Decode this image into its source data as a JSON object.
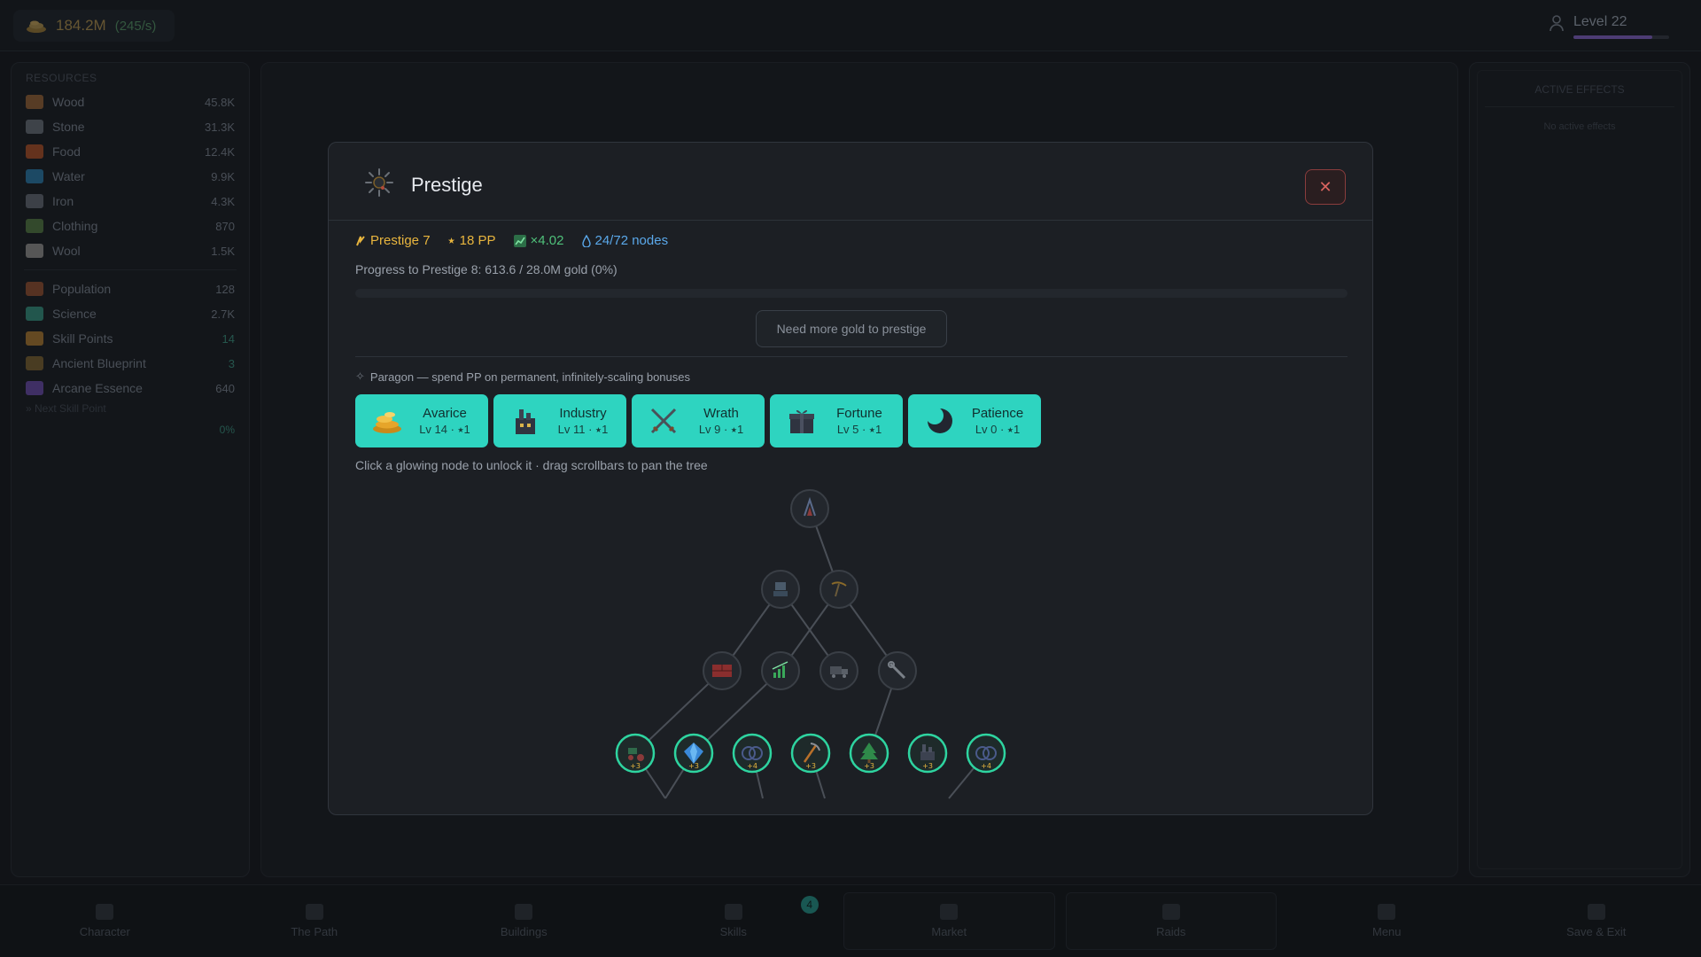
{
  "topbar": {
    "gold_value": "184.2M",
    "gold_rate": "(245/s)",
    "level_label": "Level 22",
    "level_progress": 0.82
  },
  "sidebar": {
    "title": "RESOURCES",
    "resources": [
      {
        "name": "Wood",
        "value": "45.8K",
        "icon": "wood-icon",
        "color": "#6b4a2e"
      },
      {
        "name": "Stone",
        "value": "31.3K",
        "icon": "stone-icon",
        "color": "#4c525a"
      },
      {
        "name": "Food",
        "value": "12.4K",
        "icon": "food-icon",
        "color": "#7a3e24"
      },
      {
        "name": "Water",
        "value": "9.9K",
        "icon": "water-icon",
        "color": "#235a7a"
      },
      {
        "name": "Iron",
        "value": "4.3K",
        "icon": "iron-icon",
        "color": "#4a4f57"
      },
      {
        "name": "Clothing",
        "value": "870",
        "icon": "clothing-icon",
        "color": "#3f5a36"
      },
      {
        "name": "Wool",
        "value": "1.5K",
        "icon": "wool-icon",
        "color": "#6a6a6a"
      }
    ],
    "stats": [
      {
        "name": "Population",
        "value": "128",
        "icon": "population-icon",
        "color": "#6a3e2a",
        "teal": false
      },
      {
        "name": "Science",
        "value": "2.7K",
        "icon": "science-icon",
        "color": "#2a6a5e",
        "teal": false
      },
      {
        "name": "Skill Points",
        "value": "14",
        "icon": "skill-points-icon",
        "color": "#7a5a2a",
        "teal": true
      },
      {
        "name": "Ancient Blueprint",
        "value": "3",
        "icon": "blueprint-icon",
        "color": "#5a4a2a",
        "teal": true
      },
      {
        "name": "Arcane Essence",
        "value": "640",
        "icon": "arcane-icon",
        "color": "#4e3a7a",
        "teal": false
      }
    ],
    "next_skill_point": "» Next Skill Point",
    "next_skill_pct": "0%"
  },
  "active_effects": {
    "title": "ACTIVE EFFECTS",
    "empty": "No active effects"
  },
  "modal": {
    "title": "Prestige",
    "close_label": "✕",
    "prestige_level": "Prestige 7",
    "pp": "18 PP",
    "multiplier": "×4.02",
    "nodes": "24/72 nodes",
    "progress_text": "Progress to Prestige 8:  613.6 / 28.0M gold  (0%)",
    "progress_fraction": 0.0,
    "need_more": "Need more gold to prestige",
    "paragon_header": "Paragon — spend PP on permanent, infinitely-scaling bonuses",
    "paragon": [
      {
        "name": "Avarice",
        "level": "Lv 14  ·  ⭑1",
        "icon": "gold-coins-icon"
      },
      {
        "name": "Industry",
        "level": "Lv 11  ·  ⭑1",
        "icon": "factory-icon"
      },
      {
        "name": "Wrath",
        "level": "Lv 9  ·  ⭑1",
        "icon": "crossed-swords-icon"
      },
      {
        "name": "Fortune",
        "level": "Lv 5  ·  ⭑1",
        "icon": "gift-icon"
      },
      {
        "name": "Patience",
        "level": "Lv 0  ·  ⭑1",
        "icon": "moon-icon"
      }
    ],
    "hint": "Click a glowing node to unlock it · drag scrollbars to pan the tree",
    "tree_nodes": [
      {
        "name": "tree-root-node",
        "icon": "spire-icon",
        "badge": ""
      },
      {
        "name": "tree-node-1a",
        "icon": "robot-icon",
        "badge": ""
      },
      {
        "name": "tree-node-1b",
        "icon": "pickaxe-gold-icon",
        "badge": ""
      },
      {
        "name": "tree-node-2a",
        "icon": "bricks-icon",
        "badge": ""
      },
      {
        "name": "tree-node-2b",
        "icon": "chart-up-icon",
        "badge": ""
      },
      {
        "name": "tree-node-2c",
        "icon": "truck-icon",
        "badge": ""
      },
      {
        "name": "tree-node-2d",
        "icon": "wrench-icon",
        "badge": ""
      },
      {
        "name": "tree-node-3a",
        "icon": "tractor-icon",
        "badge": "+3"
      },
      {
        "name": "tree-node-3b",
        "icon": "gem-icon",
        "badge": "+3"
      },
      {
        "name": "tree-node-3c",
        "icon": "rings-icon",
        "badge": "+4"
      },
      {
        "name": "tree-node-3d",
        "icon": "pickaxe-icon",
        "badge": "+3"
      },
      {
        "name": "tree-node-3e",
        "icon": "tree-icon",
        "badge": "+3"
      },
      {
        "name": "tree-node-3f",
        "icon": "factory-small-icon",
        "badge": "+3"
      },
      {
        "name": "tree-node-3g",
        "icon": "rings-icon",
        "badge": "+4"
      }
    ]
  },
  "bottomnav": [
    {
      "label": "Character",
      "icon": "character-icon"
    },
    {
      "label": "The Path",
      "icon": "path-icon"
    },
    {
      "label": "Buildings",
      "icon": "buildings-icon"
    },
    {
      "label": "Skills",
      "icon": "skills-icon",
      "badge": "4"
    },
    {
      "label": "Market",
      "icon": "market-icon"
    },
    {
      "label": "Raids",
      "icon": "raids-icon"
    },
    {
      "label": "Menu",
      "icon": "menu-icon"
    },
    {
      "label": "Save & Exit",
      "icon": "save-icon"
    }
  ],
  "colors": {
    "accent": "#2ed4c0",
    "gold": "#e8b53e",
    "green": "#4fc07a",
    "blue": "#5aa8ea",
    "danger": "#d9645f"
  }
}
